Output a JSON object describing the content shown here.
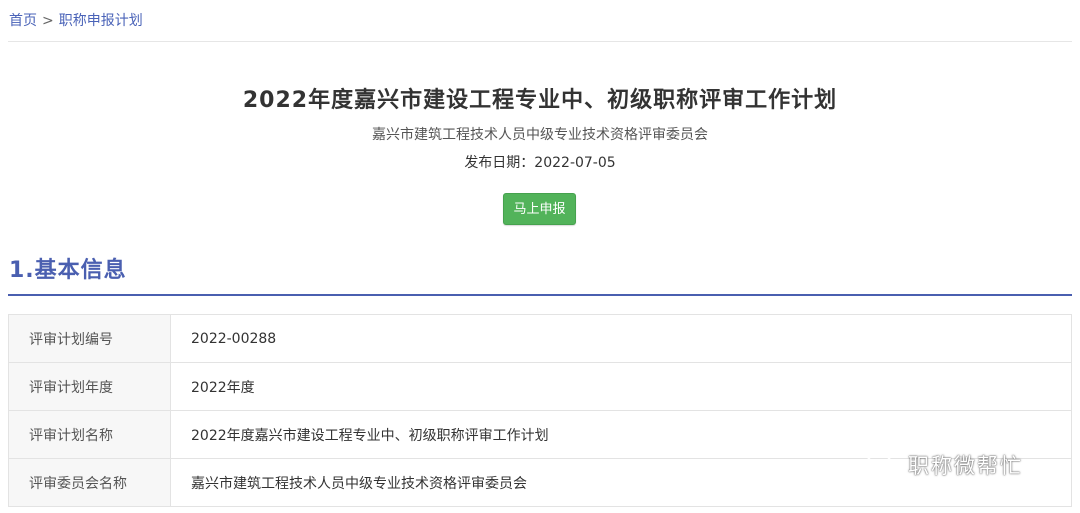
{
  "breadcrumb": {
    "home": "首页",
    "separator": ">",
    "current": "职称申报计划"
  },
  "header": {
    "title": "2022年度嘉兴市建设工程专业中、初级职称评审工作计划",
    "committee": "嘉兴市建筑工程技术人员中级专业技术资格评审委员会",
    "publish_date": "发布日期：2022-07-05",
    "apply_button": "马上申报"
  },
  "section": {
    "heading": "1.基本信息"
  },
  "info_table": [
    {
      "label": "评审计划编号",
      "value": "2022-00288"
    },
    {
      "label": "评审计划年度",
      "value": "2022年度"
    },
    {
      "label": "评审计划名称",
      "value": "2022年度嘉兴市建设工程专业中、初级职称评审工作计划"
    },
    {
      "label": "评审委员会名称",
      "value": "嘉兴市建筑工程技术人员中级专业技术资格评审委员会"
    }
  ],
  "watermark": {
    "text": "职称微帮忙",
    "icon": "wechat-icon"
  },
  "colors": {
    "link": "#4a63b8",
    "accent": "#4a5fb0",
    "button": "#52b35a"
  }
}
